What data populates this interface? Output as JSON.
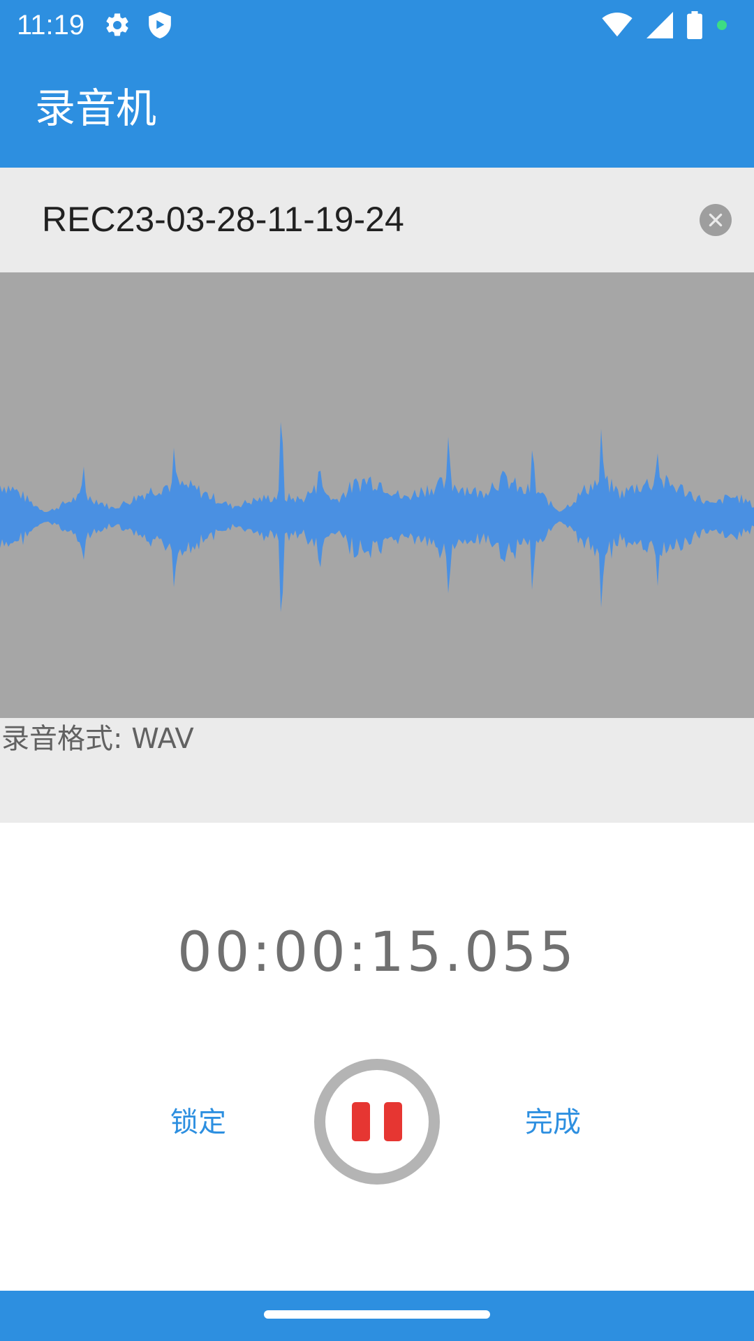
{
  "status_bar": {
    "time": "11:19",
    "left_icons": [
      "gear-icon",
      "shield-play-icon"
    ],
    "right_icons": [
      "wifi-icon",
      "signal-icon",
      "battery-icon",
      "dot-indicator-icon"
    ],
    "dot_color": "#3ddc84"
  },
  "app_bar": {
    "title": "录音机",
    "background": "#2d8fe0"
  },
  "recording": {
    "filename": "REC23-03-28-11-19-24",
    "clear_icon": "close-circle-icon",
    "format_label": "录音格式: WAV",
    "elapsed": "00:00:15.055"
  },
  "waveform": {
    "color": "#4a90e2",
    "background": "#a6a6a6"
  },
  "controls": {
    "lock_label": "锁定",
    "done_label": "完成",
    "pause_icon": "pause-icon",
    "pause_color": "#e63632"
  }
}
